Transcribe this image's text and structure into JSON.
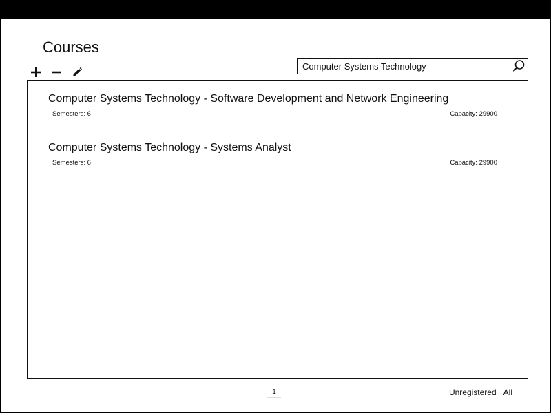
{
  "header": {
    "title": "Courses"
  },
  "toolbar": {
    "add_icon": "plus-icon",
    "remove_icon": "minus-icon",
    "edit_icon": "pencil-icon"
  },
  "search": {
    "value": "Computer Systems Technology",
    "icon": "search-icon"
  },
  "courses": [
    {
      "name": "Computer Systems Technology - Software Development and Network Engineering",
      "semesters": "Semesters: 6",
      "capacity": "Capacity: 29900"
    },
    {
      "name": "Computer Systems Technology - Systems Analyst",
      "semesters": "Semesters: 6",
      "capacity": "Capacity: 29900"
    }
  ],
  "pagination": {
    "current_page": "1"
  },
  "footer": {
    "unregistered": "Unregistered",
    "all": "All"
  }
}
